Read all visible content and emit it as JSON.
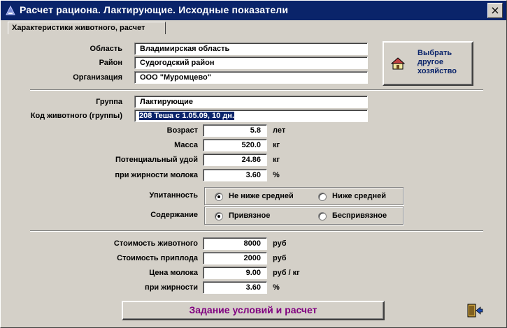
{
  "window": {
    "title": "Расчет рациона. Лактирующие. Исходные показатели",
    "close_label": "×"
  },
  "tab": {
    "label": "Характеристики животного, расчет"
  },
  "location": {
    "region_label": "Область",
    "region_value": "Владимирская область",
    "district_label": "Район",
    "district_value": "Судогодский район",
    "org_label": "Организация",
    "org_value": "ООО \"Муромцево\""
  },
  "choose_farm_button": {
    "line1": "Выбрать",
    "line2": "другое",
    "line3": "хозяйство"
  },
  "animal": {
    "group_label": "Группа",
    "group_value": "Лактирующие",
    "code_label": "Код животного (группы)",
    "code_value": "208  Теша  с  1.05.09, 10 дн."
  },
  "params": {
    "age_label": "Возраст",
    "age_value": "5.8",
    "age_unit": "лет",
    "mass_label": "Масса",
    "mass_value": "520.0",
    "mass_unit": "кг",
    "yield_label": "Потенциальный удой",
    "yield_value": "24.86",
    "yield_unit": "кг",
    "fat_label": "при жирности молока",
    "fat_value": "3.60",
    "fat_unit": "%"
  },
  "condition": {
    "label": "Упитанность",
    "option1": "Не ниже средней",
    "option2": "Ниже средней",
    "selected": "option1"
  },
  "housing": {
    "label": "Содержание",
    "option1": "Привязное",
    "option2": "Беспривязное",
    "selected": "option1"
  },
  "costs": {
    "animal_label": "Стоимость животного",
    "animal_value": "8000",
    "animal_unit": "руб",
    "offspring_label": "Стоимость приплода",
    "offspring_value": "2000",
    "offspring_unit": "руб",
    "milk_label": "Цена молока",
    "milk_value": "9.00",
    "milk_unit": "руб / кг",
    "milkfat_label": "при жирности",
    "milkfat_value": "3.60",
    "milkfat_unit": "%"
  },
  "calc_button": {
    "label": "Задание условий и расчет"
  },
  "icons": {
    "title": "app-icon",
    "farm": "house-icon",
    "exit": "exit-door-icon"
  }
}
